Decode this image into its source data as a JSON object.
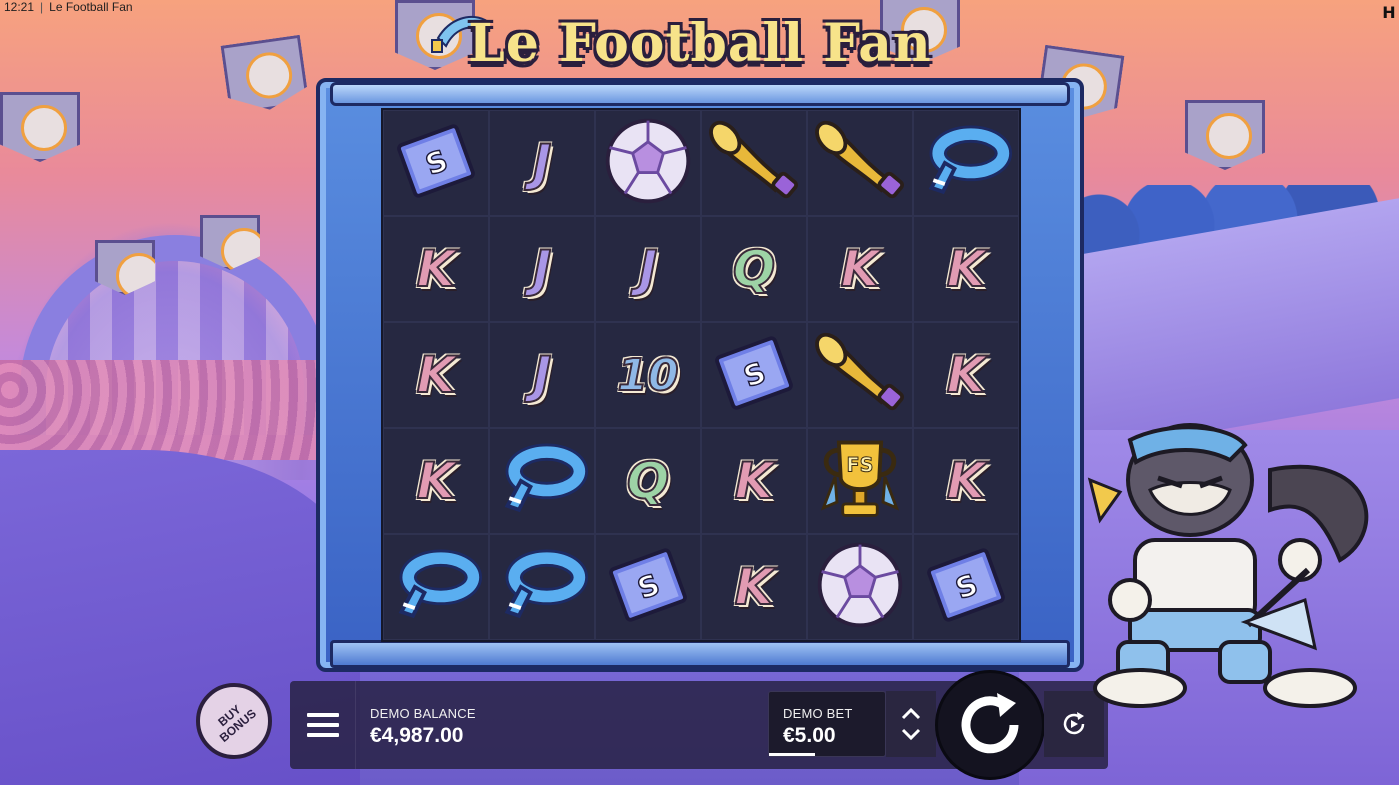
{
  "status_bar": {
    "time": "12:21",
    "window_title": "Le Football Fan",
    "brand_logo": "H"
  },
  "game": {
    "title": "Le Football Fan"
  },
  "reels": [
    [
      "ticket",
      "J",
      "ball",
      "horn",
      "horn",
      "scarf"
    ],
    [
      "K",
      "J",
      "J",
      "Q",
      "K",
      "K"
    ],
    [
      "K",
      "J",
      "10",
      "ticket",
      "horn",
      "K"
    ],
    [
      "K",
      "scarf",
      "Q",
      "K",
      "trophy",
      "K"
    ],
    [
      "scarf",
      "scarf",
      "ticket",
      "K",
      "ball",
      "ticket"
    ]
  ],
  "symbol_colors": {
    "K": "#e29bb3",
    "J": "#a996e6",
    "Q": "#9dd3a6",
    "10": "#8fb8e6"
  },
  "trophy_text": "FS",
  "controls": {
    "buy_bonus_label": "BUY BONUS",
    "balance_label": "DEMO BALANCE",
    "balance_value": "€4,987.00",
    "bet_label": "DEMO BET",
    "bet_value": "€5.00",
    "bet_level": 0.4,
    "menu_icon": "hamburger-menu-icon",
    "bet_up_icon": "chevron-up-icon",
    "bet_down_icon": "chevron-down-icon",
    "spin_icon": "spin-arrow-icon",
    "autoplay_icon": "autoplay-icon"
  }
}
